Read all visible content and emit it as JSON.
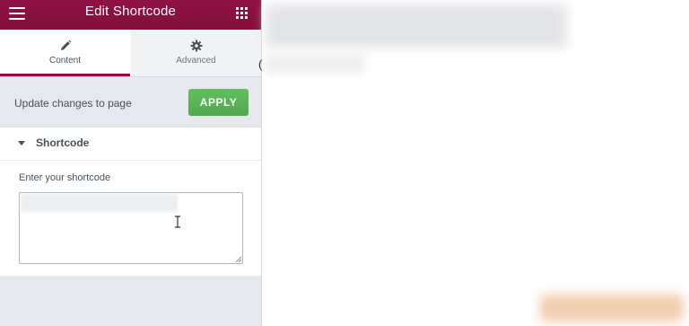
{
  "panel": {
    "title": "Edit Shortcode",
    "menu_icon": "hamburger-menu-icon",
    "grid_icon": "apps-grid-icon"
  },
  "tabs": [
    {
      "label": "Content",
      "icon": "pencil-icon",
      "active": true
    },
    {
      "label": "Advanced",
      "icon": "gear-icon",
      "active": false
    }
  ],
  "apply_bar": {
    "text": "Update changes to page",
    "button_label": "APPLY"
  },
  "section": {
    "title": "Shortcode",
    "expanded": true,
    "field_label": "Enter your shortcode"
  },
  "edge_text": "(",
  "colors": {
    "topbar": "#93003c",
    "apply_button": "#5cb85c",
    "panel_bg": "#e6e8ed",
    "active_tab_border": "#93003c"
  }
}
